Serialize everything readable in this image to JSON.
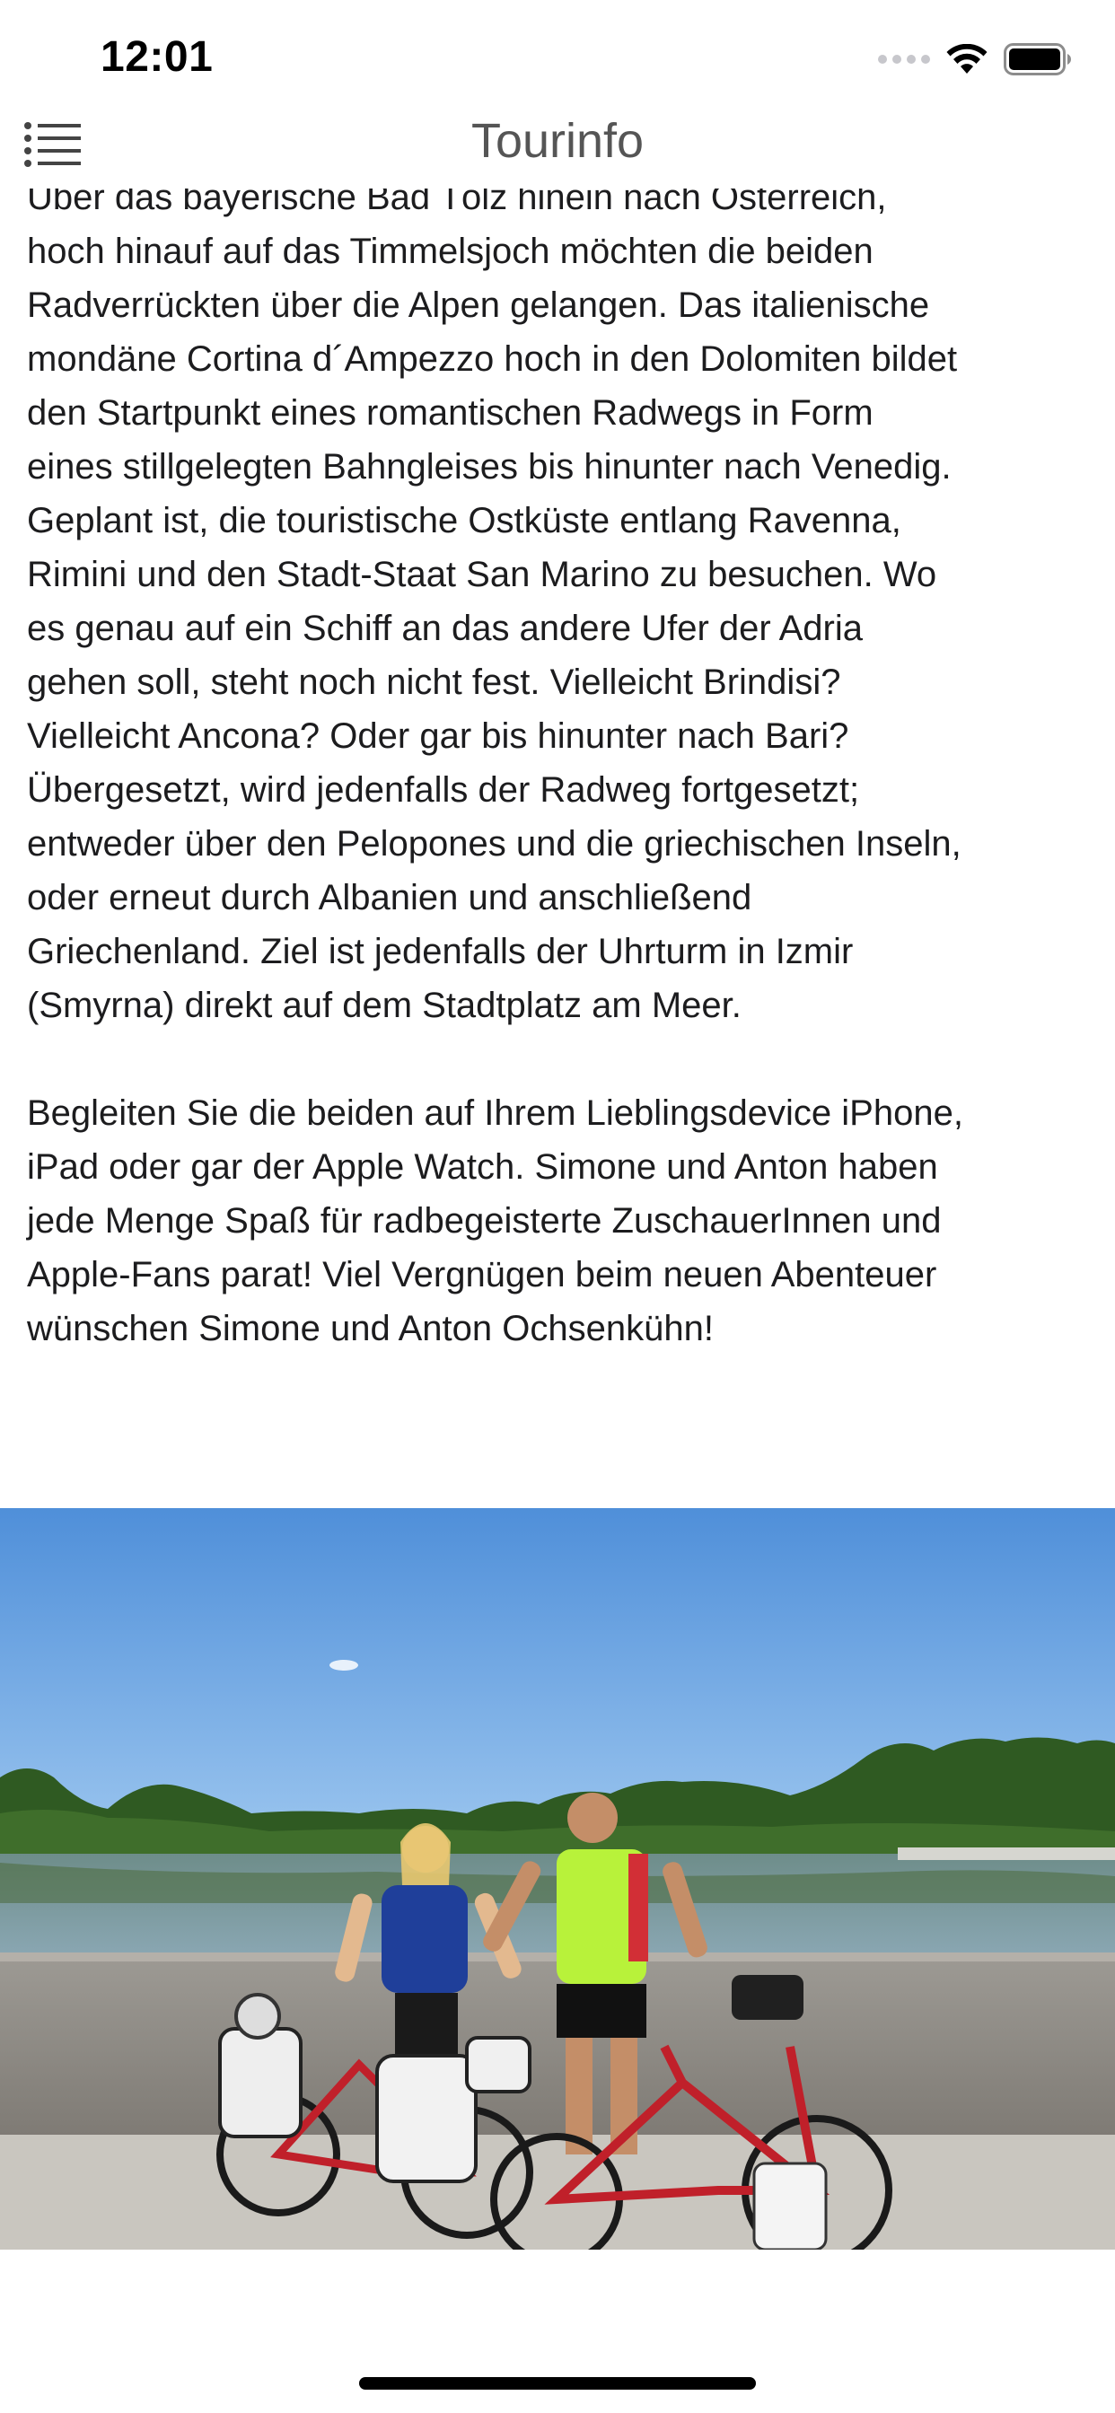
{
  "status_bar": {
    "time": "12:01",
    "icons": [
      "cellular-signal-icon",
      "wifi-icon",
      "battery-icon"
    ]
  },
  "nav": {
    "title": "Tourinfo",
    "menu_icon": "list-menu-icon"
  },
  "article": {
    "paragraphs": [
      "Über das bayerische Bad Tölz hinein nach Österreich,\nhoch hinauf auf das Timmelsjoch möchten die beiden\nRadverrückten über die Alpen gelangen. Das italienische\nmondäne Cortina d´Ampezzo hoch in den Dolomiten bildet\nden Startpunkt eines romantischen Radwegs in Form\neines stillgelegten Bahngleises bis hinunter nach Venedig.\nGeplant ist, die touristische Ostküste entlang Ravenna,\nRimini und den Stadt-Staat San Marino zu besuchen. Wo\nes genau auf ein Schiff an das andere Ufer der Adria\ngehen soll, steht noch nicht fest. Vielleicht Brindisi?\nVielleicht Ancona? Oder gar bis hinunter nach Bari?\nÜbergesetzt, wird jedenfalls der Radweg fortgesetzt;\nentweder über den Pelopones und die griechischen Inseln,\noder erneut durch Albanien und anschließend\nGriechenland. Ziel ist jedenfalls der Uhrturm in Izmir\n(Smyrna) direkt auf dem Stadtplatz am Meer.",
      "Begleiten Sie die beiden auf Ihrem Lieblingsdevice iPhone,\niPad oder gar der Apple Watch. Simone und Anton haben\njede Menge Spaß für radbegeisterte ZuschauerInnen und\nApple-Fans parat! Viel Vergnügen beim neuen Abenteuer\nwünschen Simone und Anton Ochsenkühn!"
    ]
  },
  "photo": {
    "subject": "two-cyclists-with-loaded-touring-bikes-by-lake"
  },
  "colors": {
    "nav_title": "#555555",
    "text": "#1c1c1e",
    "sky": "#5f9be0",
    "bike_frame": "#c0202a",
    "jersey": "#b8f23a"
  }
}
